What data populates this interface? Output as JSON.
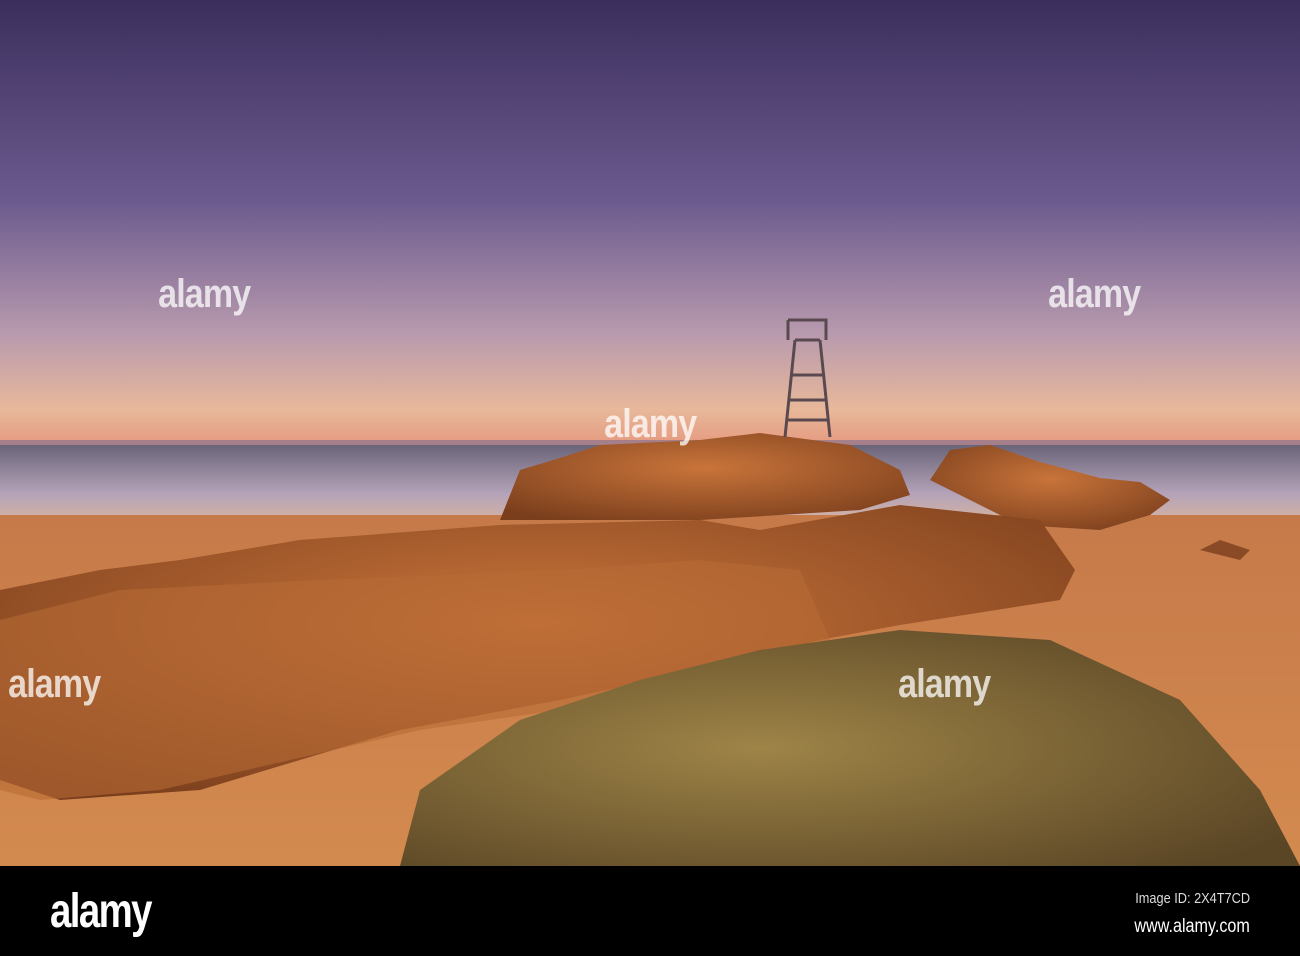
{
  "watermark": {
    "text": "alamy"
  },
  "footer": {
    "logo": "alamy",
    "image_id": "Image ID: 2X4T7CD",
    "website": "www.alamy.com"
  }
}
